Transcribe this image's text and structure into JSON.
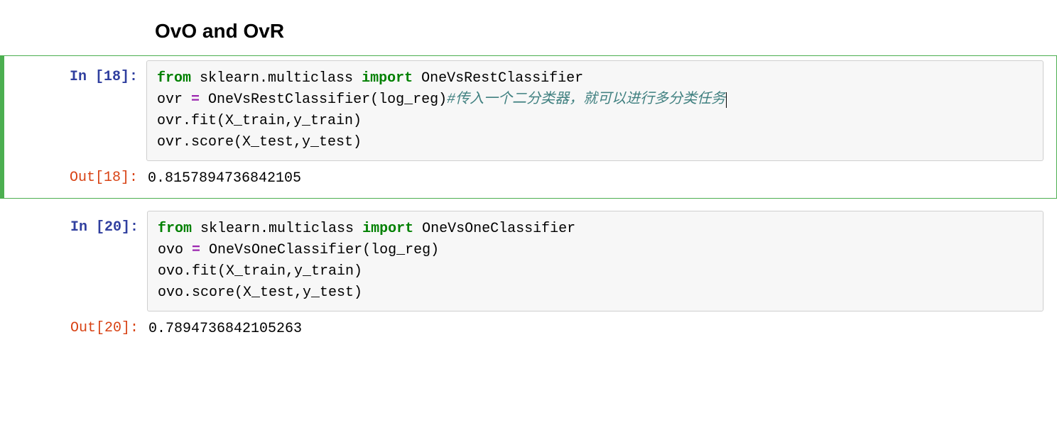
{
  "heading": "OvO and OvR",
  "cells": [
    {
      "exec_count": 18,
      "in_prompt": "In [18]:",
      "out_prompt": "Out[18]:",
      "code": {
        "line1_from": "from",
        "line1_mod": " sklearn.multiclass ",
        "line1_import": "import",
        "line1_name": " OneVsRestClassifier",
        "line2_pre": "ovr ",
        "line2_eq": "=",
        "line2_post": " OneVsRestClassifier(log_reg)",
        "line2_comment": "#传入一个二分类器，就可以进行多分类任务",
        "line3": "ovr.fit(X_train,y_train)",
        "line4": "ovr.score(X_test,y_test)"
      },
      "output": "0.8157894736842105",
      "selected": true,
      "has_cursor": true
    },
    {
      "exec_count": 20,
      "in_prompt": "In [20]:",
      "out_prompt": "Out[20]:",
      "code": {
        "line1_from": "from",
        "line1_mod": " sklearn.multiclass ",
        "line1_import": "import",
        "line1_name": " OneVsOneClassifier",
        "line2_pre": "ovo ",
        "line2_eq": "=",
        "line2_post": " OneVsOneClassifier(log_reg)",
        "line2_comment": "",
        "line3": "ovo.fit(X_train,y_train)",
        "line4": "ovo.score(X_test,y_test)"
      },
      "output": "0.7894736842105263",
      "selected": false,
      "has_cursor": false
    }
  ]
}
